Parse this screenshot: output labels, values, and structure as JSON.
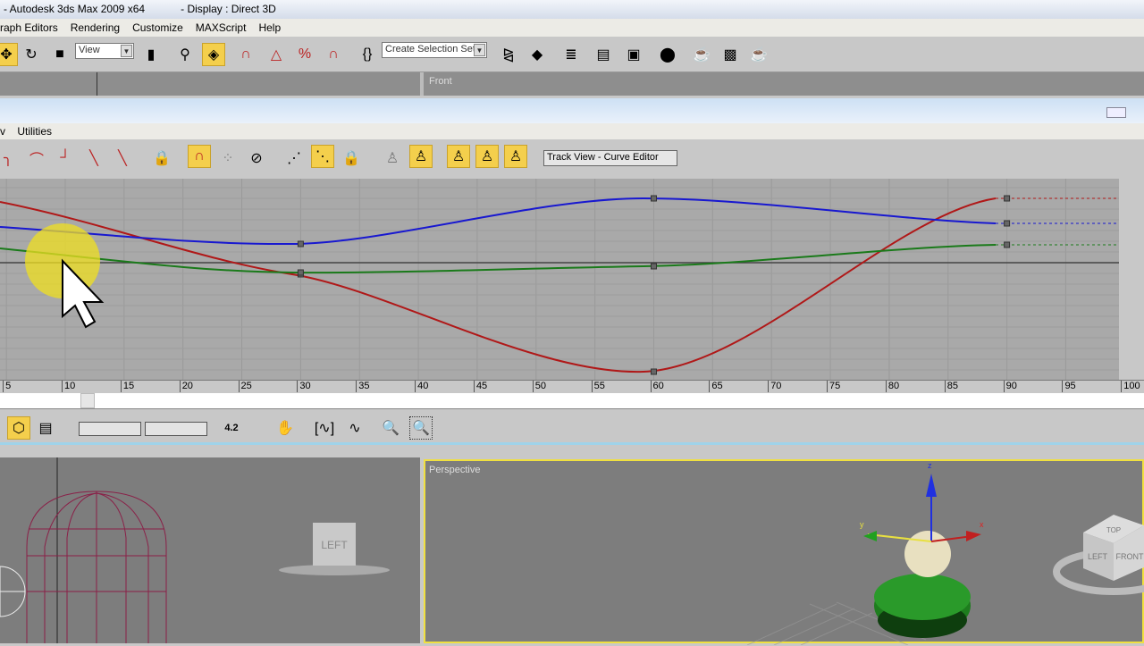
{
  "window": {
    "title": "- Autodesk 3ds Max  2009 x64",
    "display": "- Display : Direct 3D"
  },
  "menu": [
    "raph Editors",
    "Rendering",
    "Customize",
    "MAXScript",
    "Help"
  ],
  "toolbar": {
    "view_select": "View",
    "selection_set_select": "Create Selection Set"
  },
  "viewport_top": {
    "label": "Front"
  },
  "trackview": {
    "menu": [
      "v",
      "Utilities"
    ],
    "name_field": "Track View - Curve Editor",
    "ruler_ticks": [
      5,
      10,
      15,
      20,
      25,
      30,
      35,
      40,
      45,
      50,
      55,
      60,
      65,
      70,
      75,
      80,
      85,
      90,
      95,
      100
    ],
    "key_frames": [
      30,
      60,
      90
    ],
    "curve_colors": {
      "x": "#b01818",
      "y": "#1818d0",
      "z": "#1a7a1a"
    },
    "value_readout": "4.2"
  },
  "viewports": {
    "left_label": "LEFT",
    "perspective": "Perspective",
    "viewcube": [
      "TOP",
      "LEFT",
      "FRONT"
    ],
    "gizmo_axes": [
      "x",
      "y",
      "z"
    ]
  },
  "colors": {
    "active_button": "#f4cf4c",
    "active_viewport_border": "#f0e040"
  }
}
